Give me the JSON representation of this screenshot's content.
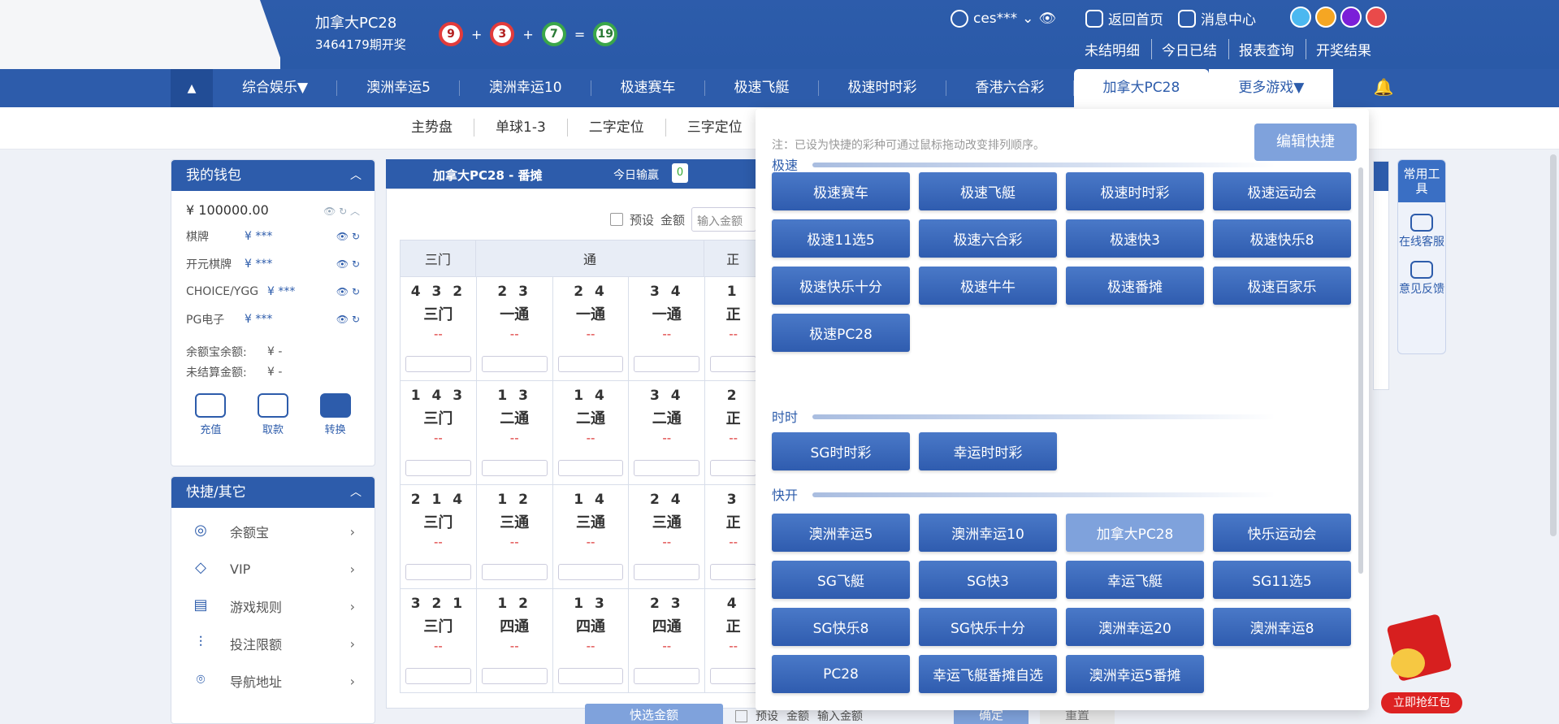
{
  "header": {
    "lottery_name": "加拿大PC28",
    "issue": "3464179期开奖",
    "balls": [
      {
        "value": "9",
        "color": "#e23b3b"
      },
      {
        "value": "3",
        "color": "#e23b3b"
      },
      {
        "value": "7",
        "color": "#3aa64a"
      },
      {
        "value": "19",
        "color": "#3aa64a"
      }
    ],
    "plus": "+",
    "equals": "=",
    "username": "ces***",
    "home_label": "返回首页",
    "message_label": "消息中心",
    "theme_colors": [
      "#4bb8f0",
      "#f5a623",
      "#7b1fd8",
      "#e94a4a"
    ],
    "sub_links": [
      "未结明细",
      "今日已结",
      "报表查询",
      "开奖结果"
    ]
  },
  "nav": {
    "up_icon": "▲",
    "items": [
      "综合娱乐▼",
      "澳洲幸运5",
      "澳洲幸运10",
      "极速赛车",
      "极速飞艇",
      "极速时时彩",
      "香港六合彩",
      "加拿大PC28",
      "更多游戏▼"
    ],
    "active_index": 7,
    "bell_icon": "bell-icon"
  },
  "subtabs": [
    "主势盘",
    "单球1-3",
    "二字定位",
    "三字定位"
  ],
  "wallet": {
    "title": "我的钱包",
    "balance": "¥ 100000.00",
    "rows": [
      {
        "name": "棋牌",
        "value": "¥ ***"
      },
      {
        "name": "开元棋牌",
        "value": "¥ ***"
      },
      {
        "name": "CHOICE/YGG",
        "value": "¥ ***"
      },
      {
        "name": "PG电子",
        "value": "¥ ***"
      }
    ],
    "summary": [
      {
        "name": "余额宝余额:",
        "value": "¥ -"
      },
      {
        "name": "未结算金额:",
        "value": "¥ -"
      }
    ],
    "actions": [
      "充值",
      "取款",
      "转换"
    ]
  },
  "quick": {
    "title": "快捷/其它",
    "items": [
      "余额宝",
      "VIP",
      "游戏规则",
      "投注限额",
      "导航地址"
    ]
  },
  "board": {
    "title": "加拿大PC28 - 番摊",
    "today_label": "今日输赢",
    "today_value": "0",
    "preset_label": "预设",
    "amount_label": "金额",
    "amount_placeholder": "输入金额",
    "headers": [
      "三门",
      "通",
      "正"
    ],
    "rows": [
      [
        {
          "nums": "4 3 2",
          "label": "三门",
          "odd": "--"
        },
        {
          "nums": "2 3",
          "label": "一通",
          "odd": "--"
        },
        {
          "nums": "2 4",
          "label": "一通",
          "odd": "--"
        },
        {
          "nums": "3 4",
          "label": "一通",
          "odd": "--"
        },
        {
          "nums": "1",
          "label": "正",
          "odd": "--"
        }
      ],
      [
        {
          "nums": "1 4 3",
          "label": "三门",
          "odd": "--"
        },
        {
          "nums": "1 3",
          "label": "二通",
          "odd": "--"
        },
        {
          "nums": "1 4",
          "label": "二通",
          "odd": "--"
        },
        {
          "nums": "3 4",
          "label": "二通",
          "odd": "--"
        },
        {
          "nums": "2",
          "label": "正",
          "odd": "--"
        }
      ],
      [
        {
          "nums": "2 1 4",
          "label": "三门",
          "odd": "--"
        },
        {
          "nums": "1 2",
          "label": "三通",
          "odd": "--"
        },
        {
          "nums": "1 4",
          "label": "三通",
          "odd": "--"
        },
        {
          "nums": "2 4",
          "label": "三通",
          "odd": "--"
        },
        {
          "nums": "3",
          "label": "正",
          "odd": "--"
        }
      ],
      [
        {
          "nums": "3 2 1",
          "label": "三门",
          "odd": "--"
        },
        {
          "nums": "1 2",
          "label": "四通",
          "odd": "--"
        },
        {
          "nums": "1 3",
          "label": "四通",
          "odd": "--"
        },
        {
          "nums": "2 3",
          "label": "四通",
          "odd": "--"
        },
        {
          "nums": "4",
          "label": "正",
          "odd": "--"
        }
      ]
    ]
  },
  "bottom_bar": {
    "quick_amount": "快选金额",
    "preset": "预设",
    "amount": "金额",
    "amount_placeholder": "输入金额",
    "confirm": "确定",
    "reset": "重置"
  },
  "tools": {
    "title": "常用工具",
    "items": [
      "在线客服",
      "意见反馈"
    ]
  },
  "redpack": {
    "label": "立即抢红包"
  },
  "dropdown": {
    "note": "注：已设为快捷的彩种可通过鼠标拖动改变排列顺序。",
    "edit_label": "编辑快捷",
    "sections": [
      {
        "title": "极速",
        "items": [
          "极速赛车",
          "极速飞艇",
          "极速时时彩",
          "极速运动会",
          "极速11选5",
          "极速六合彩",
          "极速快3",
          "极速快乐8",
          "极速快乐十分",
          "极速牛牛",
          "极速番摊",
          "极速百家乐",
          "极速PC28"
        ]
      },
      {
        "title": "时时",
        "items": [
          "SG时时彩",
          "幸运时时彩"
        ]
      },
      {
        "title": "快开",
        "items": [
          "澳洲幸运5",
          "澳洲幸运10",
          "加拿大PC28",
          "快乐运动会",
          "SG飞艇",
          "SG快3",
          "幸运飞艇",
          "SG11选5",
          "SG快乐8",
          "SG快乐十分",
          "澳洲幸运20",
          "澳洲幸运8",
          "PC28",
          "幸运飞艇番摊自选",
          "澳洲幸运5番摊"
        ]
      }
    ],
    "current": "加拿大PC28"
  }
}
